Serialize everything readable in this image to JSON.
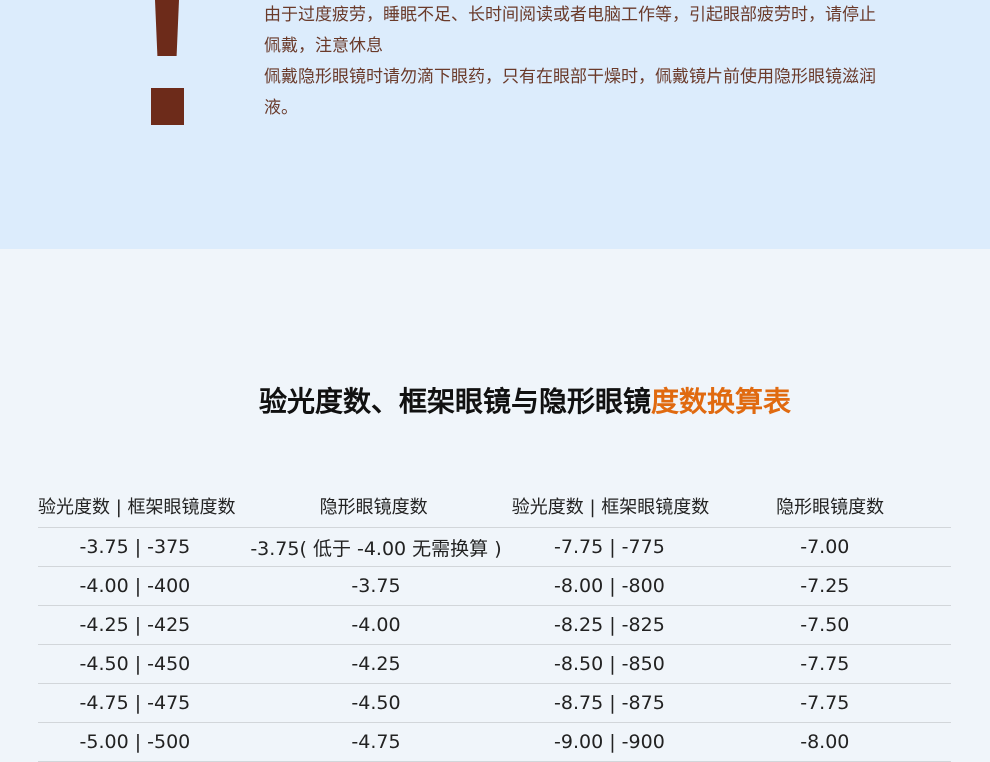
{
  "notice": {
    "line1": "由于过度疲劳，睡眠不足、长时间阅读或者电脑工作等，引起眼部疲劳时，请停止佩戴，注意休息",
    "line2": "佩戴隐形眼镜时请勿滴下眼药，只有在眼部干燥时，佩戴镜片前使用隐形眼镜滋润液。",
    "icon": "exclamation-icon",
    "icon_color": "#6d2b1a"
  },
  "title": {
    "main": "验光度数、框架眼镜与隐形眼镜",
    "accent": "度数换算表",
    "accent_color": "#e06a10"
  },
  "table": {
    "headers": [
      "验光度数 | 框架眼镜度数",
      "隐形眼镜度数",
      "验光度数 | 框架眼镜度数",
      "隐形眼镜度数"
    ],
    "rows": [
      [
        "-3.75 | -375",
        "-3.75( 低于 -4.00 无需换算 )",
        "-7.75 | -775",
        "-7.00"
      ],
      [
        "-4.00 | -400",
        "-3.75",
        "-8.00 | -800",
        "-7.25"
      ],
      [
        "-4.25 | -425",
        "-4.00",
        "-8.25 | -825",
        "-7.50"
      ],
      [
        "-4.50 | -450",
        "-4.25",
        "-8.50 | -850",
        "-7.75"
      ],
      [
        "-4.75 | -475",
        "-4.50",
        "-8.75 | -875",
        "-7.75"
      ],
      [
        "-5.00 | -500",
        "-4.75",
        "-9.00 | -900",
        "-8.00"
      ]
    ]
  },
  "colors": {
    "top_bg": "#dcecfc",
    "bottom_bg": "#f0f5fa",
    "notice_text": "#6a3a2a"
  }
}
